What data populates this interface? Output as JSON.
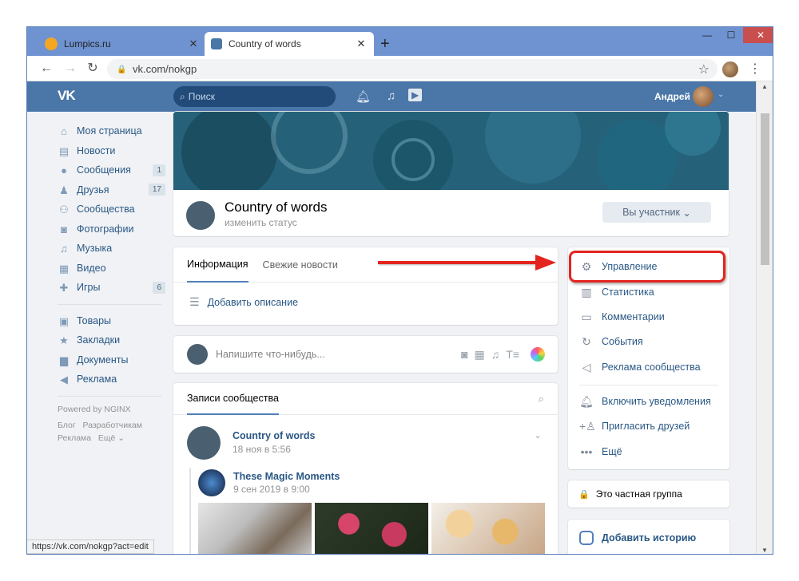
{
  "browser": {
    "tabs": [
      {
        "title": "Lumpics.ru",
        "active": false,
        "favicon_color": "#f5a623"
      },
      {
        "title": "Country of words",
        "active": true,
        "favicon_color": "#4a76a8"
      }
    ],
    "new_tab": "+",
    "url": "vk.com/nokgp",
    "status_url": "https://vk.com/nokgp?act=edit"
  },
  "vk_header": {
    "logo": "VK",
    "search_placeholder": "Поиск",
    "user_name": "Андрей"
  },
  "left_nav": {
    "items": [
      {
        "label": "Моя страница",
        "icon": "home-icon",
        "count": ""
      },
      {
        "label": "Новости",
        "icon": "news-icon",
        "count": ""
      },
      {
        "label": "Сообщения",
        "icon": "message-icon",
        "count": "1"
      },
      {
        "label": "Друзья",
        "icon": "person-icon",
        "count": "17"
      },
      {
        "label": "Сообщества",
        "icon": "group-icon",
        "count": ""
      },
      {
        "label": "Фотографии",
        "icon": "camera-icon",
        "count": ""
      },
      {
        "label": "Музыка",
        "icon": "music-icon",
        "count": ""
      },
      {
        "label": "Видео",
        "icon": "film-icon",
        "count": ""
      },
      {
        "label": "Игры",
        "icon": "gamepad-icon",
        "count": "6"
      }
    ],
    "items2": [
      {
        "label": "Товары",
        "icon": "bag-icon"
      },
      {
        "label": "Закладки",
        "icon": "star-icon"
      },
      {
        "label": "Документы",
        "icon": "document-icon"
      },
      {
        "label": "Реклама",
        "icon": "megaphone-icon"
      }
    ],
    "powered": "Powered by NGINX",
    "footer": [
      "Блог",
      "Разработчикам",
      "Реклама",
      "Ещё"
    ]
  },
  "group": {
    "name": "Country of words",
    "status": "изменить статус",
    "member_button": "Вы участник"
  },
  "info": {
    "tabs": [
      "Информация",
      "Свежие новости"
    ],
    "add_description": "Добавить описание"
  },
  "composer": {
    "placeholder": "Напишите что-нибудь..."
  },
  "wall": {
    "tab": "Записи сообщества",
    "post": {
      "author": "Country of words",
      "date": "18 ноя в 5:56",
      "repost_author": "These Magic Moments",
      "repost_date": "9 сен 2019 в 9:00"
    }
  },
  "manage_menu": {
    "items": [
      {
        "label": "Управление",
        "icon": "gear-icon"
      },
      {
        "label": "Статистика",
        "icon": "chart-icon"
      },
      {
        "label": "Комментарии",
        "icon": "comment-icon"
      },
      {
        "label": "События",
        "icon": "event-icon"
      },
      {
        "label": "Реклама сообщества",
        "icon": "megaphone-icon"
      },
      {
        "label": "Включить уведомления",
        "icon": "bell-icon"
      },
      {
        "label": "Пригласить друзей",
        "icon": "add-person-icon"
      },
      {
        "label": "Ещё",
        "icon": "more-icon"
      }
    ],
    "private_group": "Это частная группа",
    "add_story": "Добавить историю"
  },
  "colors": {
    "vk_blue": "#4a76a8",
    "link": "#2a5885",
    "highlight": "#e3241f"
  }
}
